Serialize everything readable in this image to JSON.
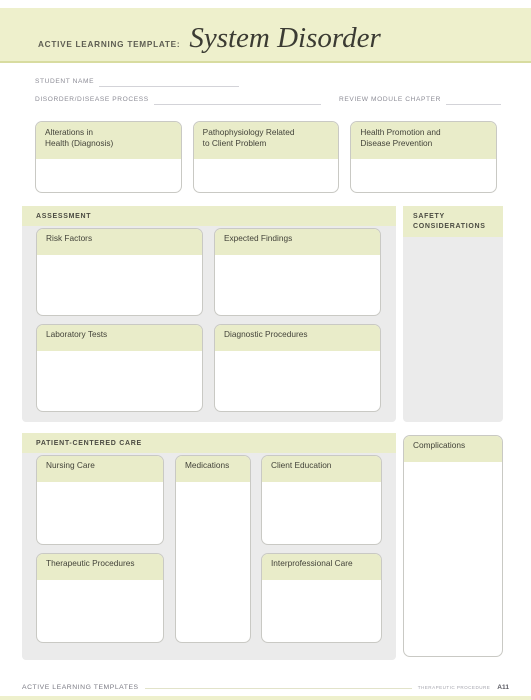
{
  "banner": {
    "kicker": "ACTIVE LEARNING TEMPLATE:",
    "title": "System Disorder"
  },
  "meta": {
    "student_name_label": "STUDENT NAME",
    "student_name_value": "",
    "disorder_label": "DISORDER/DISEASE PROCESS",
    "disorder_value": "",
    "review_module_label": "REVIEW MODULE CHAPTER",
    "review_module_value": ""
  },
  "top_cards": [
    {
      "title": "Alterations in\nHealth (Diagnosis)",
      "content": ""
    },
    {
      "title": "Pathophysiology Related\nto Client Problem",
      "content": ""
    },
    {
      "title": "Health Promotion and\nDisease Prevention",
      "content": ""
    }
  ],
  "assessment": {
    "section_label": "ASSESSMENT",
    "cards": [
      {
        "title": "Risk Factors",
        "content": ""
      },
      {
        "title": "Expected Findings",
        "content": ""
      },
      {
        "title": "Laboratory Tests",
        "content": ""
      },
      {
        "title": "Diagnostic Procedures",
        "content": ""
      }
    ]
  },
  "safety": {
    "section_label": "SAFETY\nCONSIDERATIONS",
    "content": ""
  },
  "patient_centered_care": {
    "section_label": "PATIENT-CENTERED CARE",
    "column_a": [
      {
        "title": "Nursing Care",
        "content": ""
      },
      {
        "title": "Therapeutic Procedures",
        "content": ""
      }
    ],
    "column_b": [
      {
        "title": "Medications",
        "content": ""
      }
    ],
    "column_c": [
      {
        "title": "Client Education",
        "content": ""
      },
      {
        "title": "Interprofessional Care",
        "content": ""
      }
    ]
  },
  "complications": {
    "title": "Complications",
    "content": ""
  },
  "footer": {
    "left_label": "ACTIVE LEARNING TEMPLATES",
    "chapter_label": "THERAPEUTIC PROCEDURE",
    "page_number": "A11"
  },
  "colors": {
    "banner_background": "#eef0cc",
    "banner_border": "#d8dca0",
    "card_header": "#e9ecc9",
    "panel_background": "#ebebeb",
    "panel_header": "#eaedca",
    "card_border": "#c9c9c4",
    "page_background": "#ffffff"
  }
}
